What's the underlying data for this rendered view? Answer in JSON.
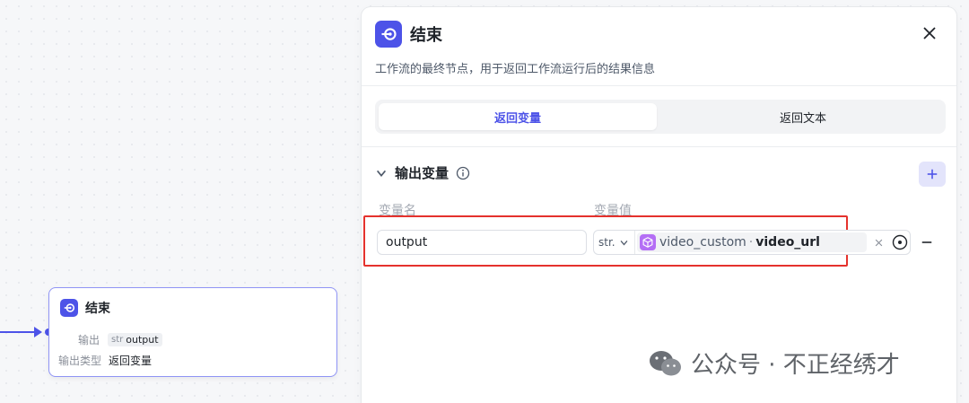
{
  "canvas_node": {
    "title": "结束",
    "output_label": "输出",
    "output_type_tag": "str",
    "output_name": "output",
    "output_type_label": "输出类型",
    "output_type_value": "返回变量"
  },
  "panel": {
    "title": "结束",
    "description": "工作流的最终节点，用于返回工作流运行后的结果信息",
    "tabs": [
      {
        "label": "返回变量",
        "active": true
      },
      {
        "label": "返回文本",
        "active": false
      }
    ],
    "section": {
      "title": "输出变量",
      "columns": {
        "name": "变量名",
        "value": "变量值"
      },
      "rows": [
        {
          "name": "output",
          "type": "str.",
          "ref_node": "video_custom",
          "ref_sep": "·",
          "ref_var": "video_url"
        }
      ]
    }
  },
  "watermark": {
    "text": "公众号 · 不正经绣才"
  },
  "colors": {
    "accent": "#4d53e8",
    "highlight": "#e5322d",
    "ref_icon": "#b46ef5"
  },
  "icons": [
    "end-node-icon",
    "close-icon",
    "info-icon",
    "chevron-down-icon",
    "plus-icon",
    "minus-icon",
    "target-icon",
    "clear-icon",
    "wechat-icon"
  ]
}
